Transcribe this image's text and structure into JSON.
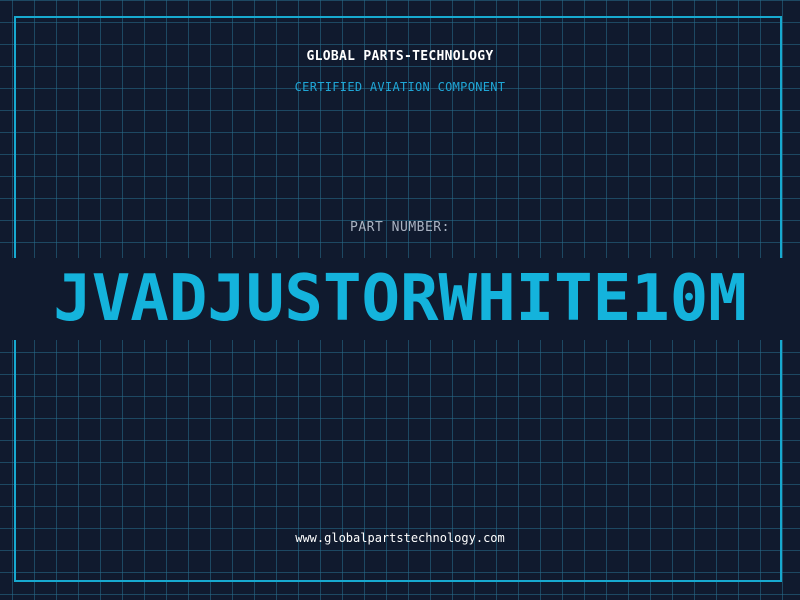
{
  "header": {
    "company": "GLOBAL PARTS-TECHNOLOGY",
    "subtitle": "CERTIFIED AVIATION COMPONENT"
  },
  "part": {
    "label": "PART NUMBER:",
    "number": "JVADJUSTORWHITE10M"
  },
  "footer": {
    "website": "www.globalpartstechnology.com"
  },
  "colors": {
    "background": "#101a2e",
    "grid": "#286e8c",
    "accent": "#17a9cf",
    "text": "#ffffff",
    "label": "#aab3c2"
  }
}
